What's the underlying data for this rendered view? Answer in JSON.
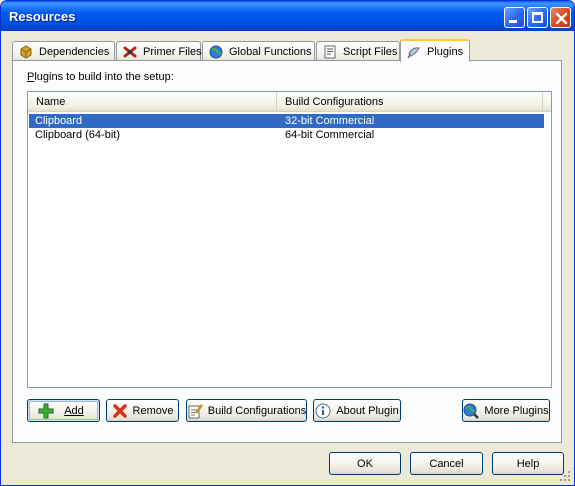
{
  "window": {
    "title": "Resources"
  },
  "tabs": [
    {
      "label": "Dependencies",
      "icon": "box-icon",
      "active": false
    },
    {
      "label": "Primer Files",
      "icon": "primer-icon",
      "active": false
    },
    {
      "label": "Global Functions",
      "icon": "globe-icon",
      "active": false
    },
    {
      "label": "Script Files",
      "icon": "script-icon",
      "active": false
    },
    {
      "label": "Plugins",
      "icon": "plugin-icon",
      "active": true
    }
  ],
  "panel": {
    "label_underline": "P",
    "label_rest": "lugins to build into the setup:"
  },
  "list": {
    "columns": [
      "Name",
      "Build Configurations"
    ],
    "rows": [
      {
        "name": "Clipboard",
        "config": "32-bit Commercial",
        "selected": true
      },
      {
        "name": "Clipboard (64-bit)",
        "config": "64-bit Commercial",
        "selected": false
      }
    ]
  },
  "buttons": {
    "add": "Add",
    "remove": "Remove",
    "build_configurations": "Build Configurations",
    "about_plugin": "About Plugin",
    "more_plugins": "More Plugins"
  },
  "footer": {
    "ok": "OK",
    "cancel": "Cancel",
    "help": "Help"
  },
  "colors": {
    "titlebar": "#0058EE",
    "selection": "#316AC5",
    "active_tab_accent": "#FFC73C",
    "face": "#ECE9D8"
  }
}
